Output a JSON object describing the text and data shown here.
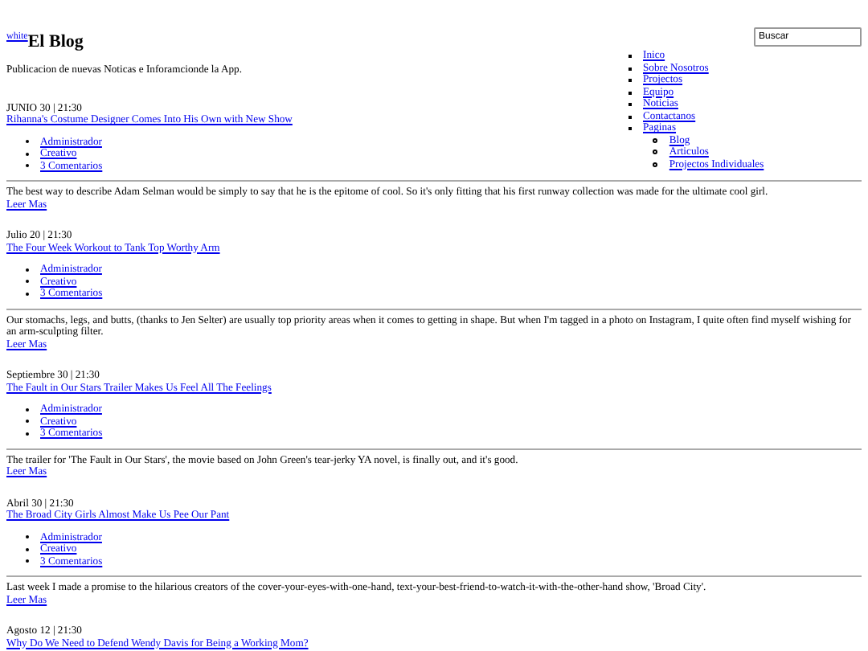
{
  "header": {
    "logo_link": "white",
    "title": "El Blog",
    "tagline": "Publicacion de nuevas Noticas e Inforamcionde la App."
  },
  "search": {
    "value": "Buscar"
  },
  "nav": [
    {
      "label": "Inico"
    },
    {
      "label": "Sobre Nosotros"
    },
    {
      "label": "Projectos"
    },
    {
      "label": "Equipo"
    },
    {
      "label": "Noticias"
    },
    {
      "label": "Contactanos"
    },
    {
      "label": "Paginas",
      "children": [
        {
          "label": "Blog"
        },
        {
          "label": "Articulos"
        },
        {
          "label": "Projectos Individuales"
        }
      ]
    }
  ],
  "posts": [
    {
      "date": "JUNIO 30 | 21:30",
      "title": "Rihanna's Costume Designer Comes Into His Own with New Show",
      "meta": [
        "Administrador",
        "Creativo",
        "3 Comentarios"
      ],
      "excerpt": "The best way to describe Adam Selman would be simply to say that he is the epitome of cool. So it's only fitting that his first runway collection was made for the ultimate cool girl.",
      "read_more": "Leer Mas"
    },
    {
      "date": "Julio 20 | 21:30",
      "title": "The Four Week Workout to Tank Top Worthy Arm",
      "meta": [
        "Administrador",
        "Creativo",
        "3 Comentarios"
      ],
      "excerpt": "Our stomachs, legs, and butts, (thanks to Jen Selter) are usually top priority areas when it comes to getting in shape. But when I'm tagged in a photo on Instagram, I quite often find myself wishing for an arm-sculpting filter.",
      "read_more": "Leer Mas"
    },
    {
      "date": "Septiembre 30 | 21:30",
      "title": "The Fault in Our Stars Trailer Makes Us Feel All The Feelings",
      "meta": [
        "Administrador",
        "Creativo",
        "3 Comentarios"
      ],
      "excerpt": "The trailer for 'The Fault in Our Stars', the movie based on John Green's tear-jerky YA novel, is finally out, and it's good.",
      "read_more": "Leer Mas"
    },
    {
      "date": "Abril 30 | 21:30",
      "title": "The Broad City Girls Almost Make Us Pee Our Pant",
      "meta": [
        "Administrador",
        "Creativo",
        "3 Comentarios"
      ],
      "excerpt": "Last week I made a promise to the hilarious creators of the cover-your-eyes-with-one-hand, text-your-best-friend-to-watch-it-with-the-other-hand show, 'Broad City'.",
      "read_more": "Leer Mas"
    },
    {
      "date": "Agosto 12 | 21:30",
      "title": "Why Do We Need to Defend Wendy Davis for Being a Working Mom?"
    }
  ]
}
